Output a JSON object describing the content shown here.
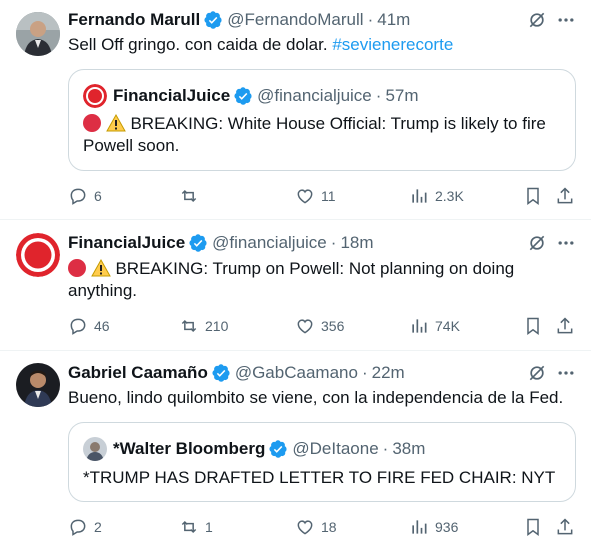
{
  "tweets": [
    {
      "author": "Fernando Marull",
      "handle": "@FernandoMarull",
      "time": "41m",
      "text": "Sell Off gringo. con caida de dolar.",
      "hashtag": "#sevienerecorte",
      "quote": {
        "author": "FinancialJuice",
        "handle": "@financialjuice",
        "time": "57m",
        "line1": "BREAKING: White House Official: Trump is likely to fire",
        "line2": "Powell soon."
      },
      "replies": "6",
      "retweets": "",
      "likes": "11",
      "views": "2.3K"
    },
    {
      "author": "FinancialJuice",
      "handle": "@financialjuice",
      "time": "18m",
      "line1": "BREAKING: Trump on Powell: Not planning on doing",
      "line2": "anything.",
      "replies": "46",
      "retweets": "210",
      "likes": "356",
      "views": "74K"
    },
    {
      "author": "Gabriel Caamaño",
      "handle": "@GabCaamano",
      "time": "22m",
      "text": "Bueno, lindo quilombito se viene, con la independencia de la Fed.",
      "quote": {
        "author": "*Walter Bloomberg",
        "handle": "@DeItaone",
        "time": "38m",
        "text": "*TRUMP HAS DRAFTED LETTER TO FIRE FED CHAIR: NYT"
      },
      "replies": "2",
      "retweets": "1",
      "likes": "18",
      "views": "936"
    }
  ],
  "colors": {
    "verified": "#1d9bf0",
    "muted": "#536471",
    "link": "#1d9bf0",
    "brand_red": "#dd2e44"
  },
  "icons": [
    "verified-badge-icon",
    "grok-icon",
    "more-icon",
    "reply-icon",
    "retweet-icon",
    "like-icon",
    "views-icon",
    "bookmark-icon",
    "share-icon"
  ]
}
